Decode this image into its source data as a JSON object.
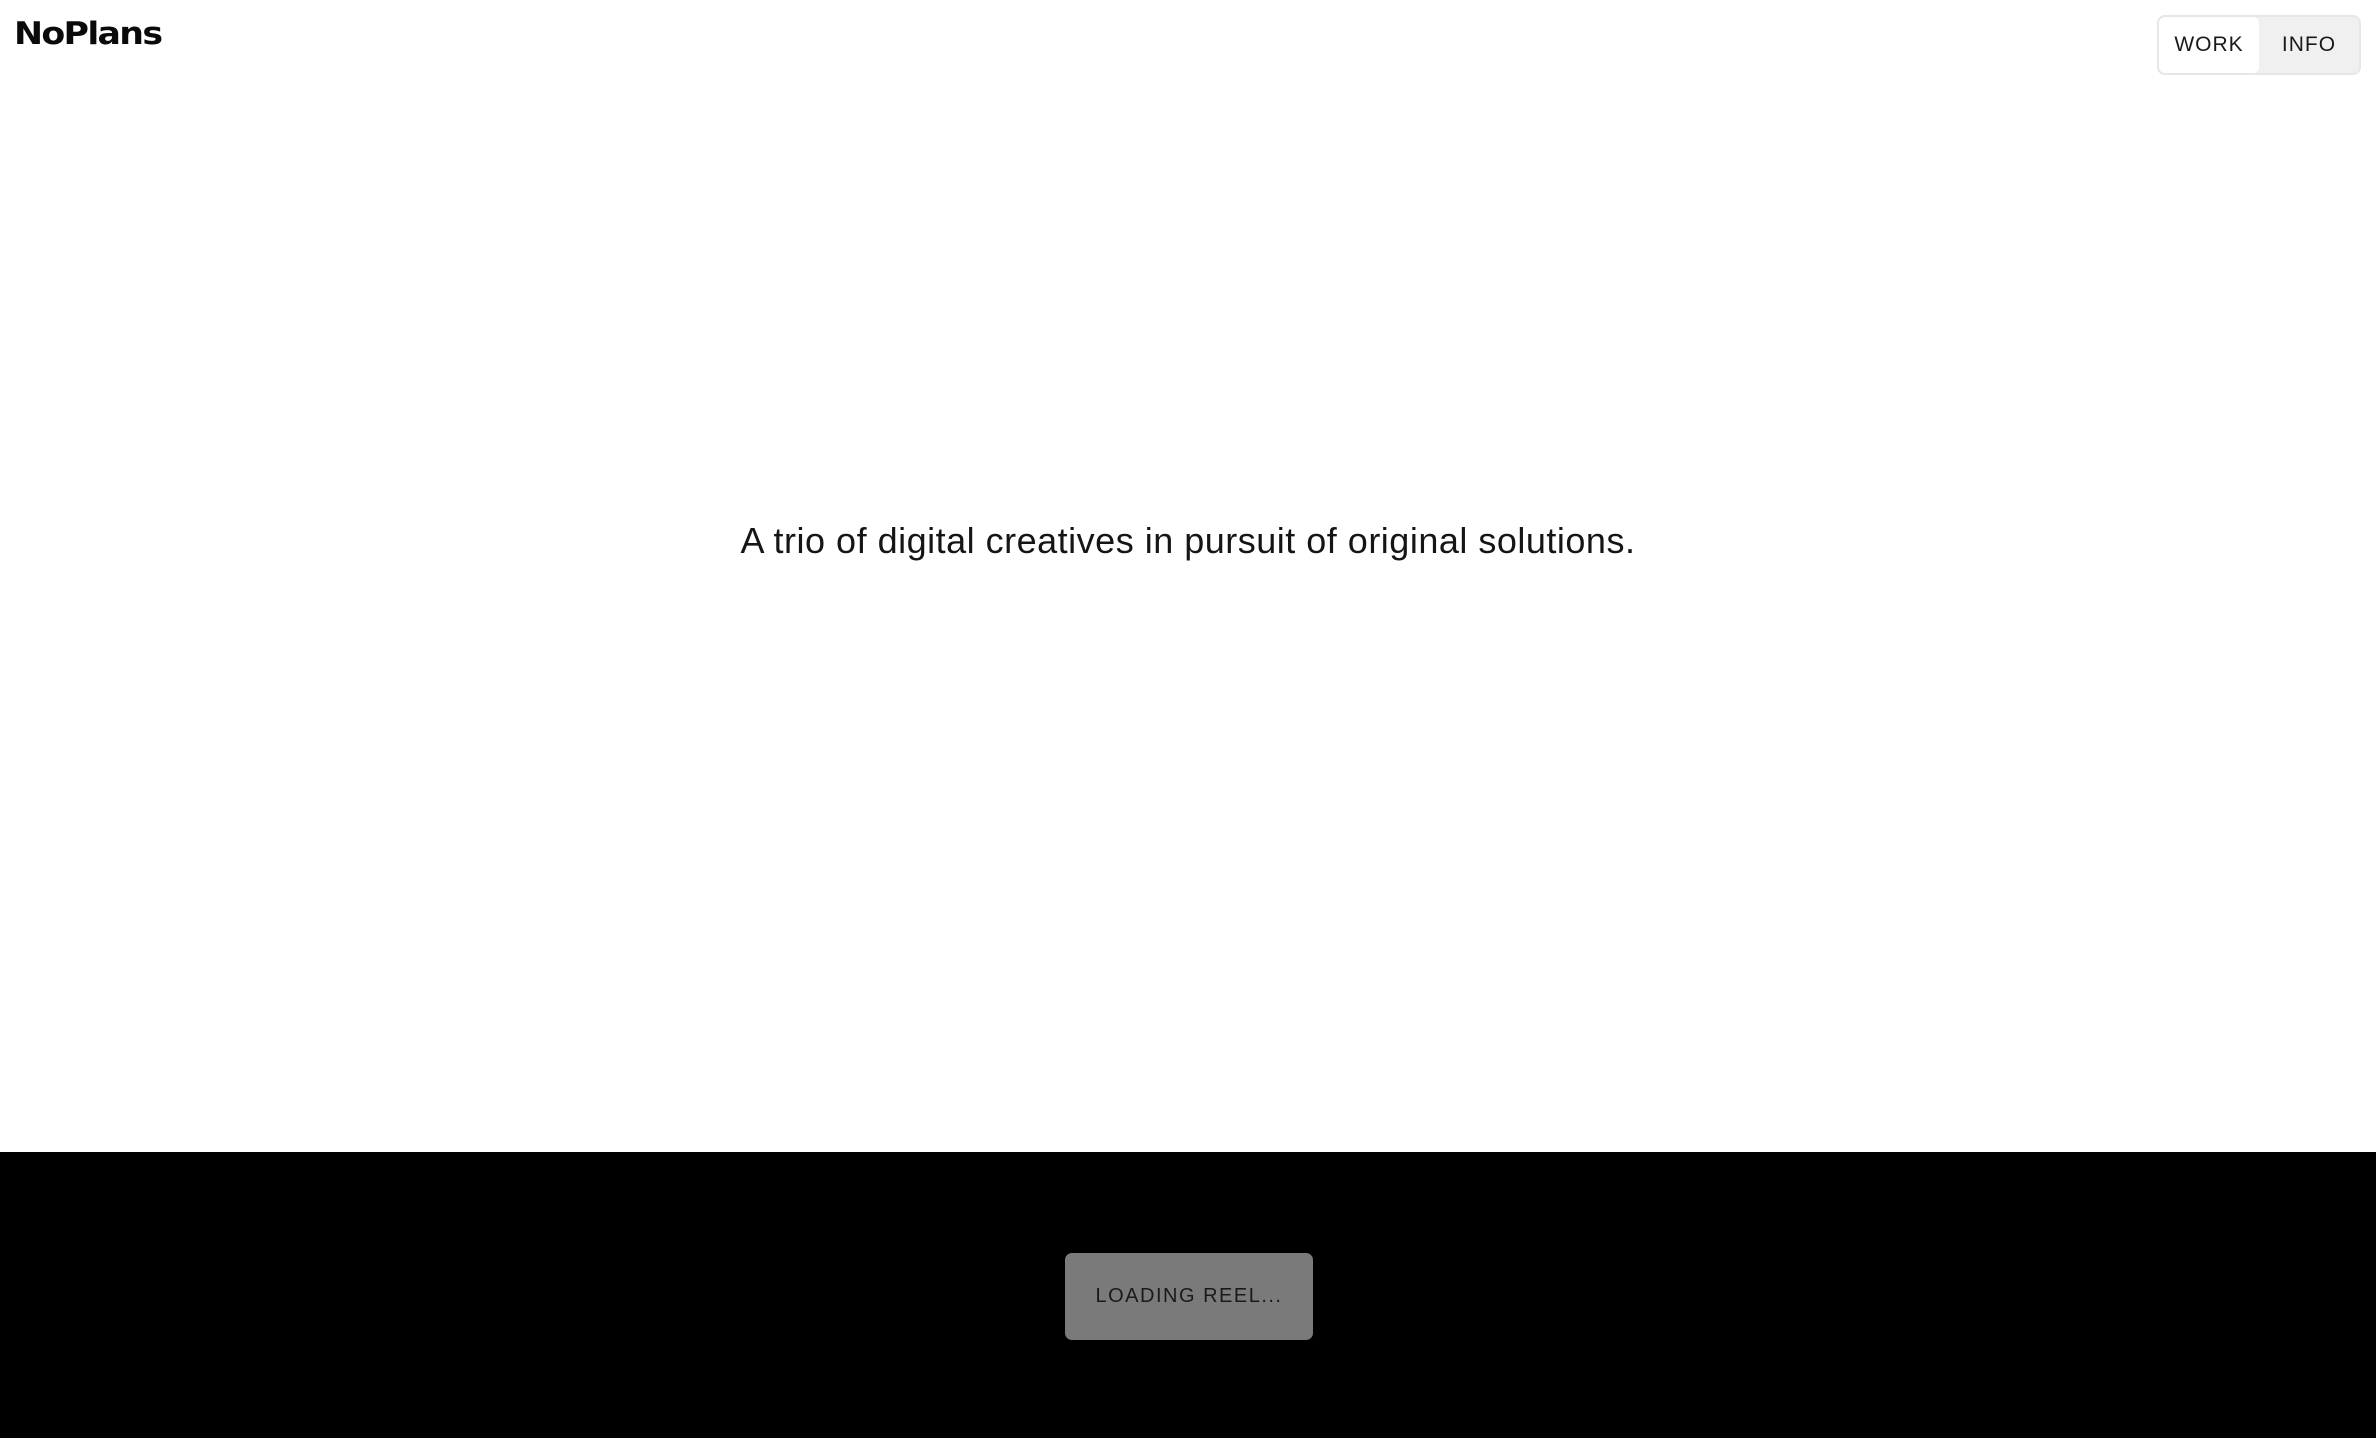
{
  "header": {
    "logo": "NoPlans",
    "nav": [
      {
        "label": "WORK"
      },
      {
        "label": "INFO"
      }
    ]
  },
  "hero": {
    "tagline": "A trio of digital creatives in pursuit of original solutions."
  },
  "reel": {
    "status": "LOADING REEL..."
  },
  "colors": {
    "background": "#ffffff",
    "reel_background": "#000000",
    "loading_button": "#7a7a7a",
    "nav_background": "#f0f0f0"
  }
}
